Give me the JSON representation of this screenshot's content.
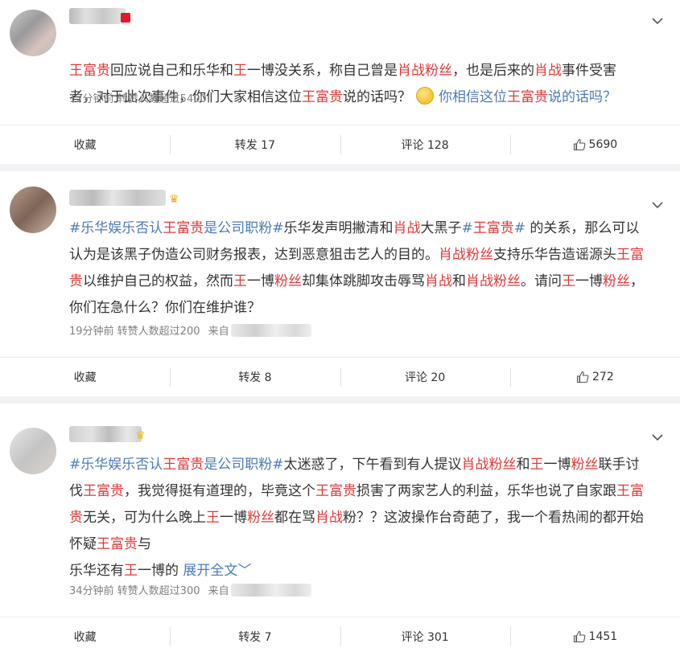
{
  "posts": [
    {
      "text_lines": [
        [
          {
            "t": "王富贵",
            "c": "hl"
          },
          {
            "t": "回应说自己和乐华和"
          },
          {
            "t": "王",
            "c": "hl"
          },
          {
            "t": "一博没关系，称自己曾是"
          },
          {
            "t": "肖战粉丝",
            "c": "hl"
          },
          {
            "t": "，也是后来的"
          },
          {
            "t": "肖战",
            "c": "hl"
          },
          {
            "t": "事件受害"
          }
        ],
        [
          {
            "t": "者，对于此次事件，你们大家相信这位"
          },
          {
            "t": "王富贵",
            "c": "hl"
          },
          {
            "t": "说的话吗？"
          },
          {
            "emoji": "thinking-emoji"
          },
          {
            "t": "你相信这位",
            "c": "q"
          },
          {
            "t": "王富贵",
            "c": "hl"
          },
          {
            "t": "说的话吗？",
            "c": "q"
          }
        ]
      ],
      "meta": "12分钟前 转赞人数超过5400",
      "source_prefix": "",
      "actions": {
        "fav": "收藏",
        "repost": "转发 17",
        "comment": "评论 128",
        "likes": "5690"
      }
    },
    {
      "text_lines": [
        [
          {
            "t": "#乐华娱乐否认",
            "c": "topic"
          },
          {
            "t": "王富贵",
            "c": "hl"
          },
          {
            "t": "是公司职粉#",
            "c": "topic"
          },
          {
            "t": "乐华发声明撇清和"
          },
          {
            "t": "肖战",
            "c": "hl"
          },
          {
            "t": "大黑子"
          },
          {
            "t": "#",
            "c": "topic"
          },
          {
            "t": "王富贵",
            "c": "hl"
          },
          {
            "t": "#",
            "c": "topic"
          },
          {
            "t": " 的关系，那么可以"
          }
        ],
        [
          {
            "t": "认为是该黑子伪造公司财务报表，达到恶意狙击艺人的目的。"
          },
          {
            "t": "肖战粉丝",
            "c": "hl"
          },
          {
            "t": "支持乐华告造谣源头"
          },
          {
            "t": "王富",
            "c": "hl"
          }
        ],
        [
          {
            "t": "贵",
            "c": "hl"
          },
          {
            "t": "以维护自己的权益，然而"
          },
          {
            "t": "王",
            "c": "hl"
          },
          {
            "t": "一博"
          },
          {
            "t": "粉丝",
            "c": "hl"
          },
          {
            "t": "却集体跳脚攻击辱骂"
          },
          {
            "t": "肖战",
            "c": "hl"
          },
          {
            "t": "和"
          },
          {
            "t": "肖战粉丝",
            "c": "hl"
          },
          {
            "t": "。请问"
          },
          {
            "t": "王",
            "c": "hl"
          },
          {
            "t": "一博"
          },
          {
            "t": "粉丝",
            "c": "hl"
          },
          {
            "t": "，"
          }
        ],
        [
          {
            "t": "你们在急什么？你们在维护谁？"
          }
        ]
      ],
      "meta": "19分钟前 转赞人数超过200",
      "source_prefix": "来自",
      "actions": {
        "fav": "收藏",
        "repost": "转发 8",
        "comment": "评论 20",
        "likes": "272"
      }
    },
    {
      "text_lines": [
        [
          {
            "t": "#乐华娱乐否认",
            "c": "topic"
          },
          {
            "t": "王富贵",
            "c": "hl"
          },
          {
            "t": "是公司职粉#",
            "c": "topic"
          },
          {
            "t": "太迷惑了，下午看到有人提议"
          },
          {
            "t": "肖战粉丝",
            "c": "hl"
          },
          {
            "t": "和"
          },
          {
            "t": "王",
            "c": "hl"
          },
          {
            "t": "一博"
          },
          {
            "t": "粉丝",
            "c": "hl"
          },
          {
            "t": "联手讨"
          }
        ],
        [
          {
            "t": "伐"
          },
          {
            "t": "王富贵",
            "c": "hl"
          },
          {
            "t": "，我觉得挺有道理的，毕竟这个"
          },
          {
            "t": "王富贵",
            "c": "hl"
          },
          {
            "t": "损害了两家艺人的利益，乐华也说了自家跟"
          },
          {
            "t": "王富",
            "c": "hl"
          }
        ],
        [
          {
            "t": "贵",
            "c": "hl"
          },
          {
            "t": "无关，可为什么晚上"
          },
          {
            "t": "王",
            "c": "hl"
          },
          {
            "t": "一博"
          },
          {
            "t": "粉丝",
            "c": "hl"
          },
          {
            "t": "都在骂"
          },
          {
            "t": "肖战",
            "c": "hl"
          },
          {
            "t": "粉？？这波操作台奇葩了，我一个看热闹的都开始"
          }
        ],
        [
          {
            "t": "怀疑"
          },
          {
            "t": "王富贵",
            "c": "hl"
          },
          {
            "t": "与"
          }
        ],
        [
          {
            "t": "乐华还有"
          },
          {
            "t": "王",
            "c": "hl"
          },
          {
            "t": "一博的  "
          },
          {
            "t": "展开全文",
            "c": "expand"
          },
          {
            "t": "﹀",
            "c": "expand"
          }
        ]
      ],
      "meta": "34分钟前 转赞人数超过300",
      "source_prefix": "来自",
      "actions": {
        "fav": "收藏",
        "repost": "转发 7",
        "comment": "评论 301",
        "likes": "1451"
      }
    }
  ],
  "icons": {
    "more": "chevron-down-icon",
    "like": "thumbs-up-icon",
    "vip": "vip-crown-icon"
  },
  "colors": {
    "highlight": "#e03a3a",
    "topic": "#4e7ab7",
    "meta": "#808080"
  }
}
